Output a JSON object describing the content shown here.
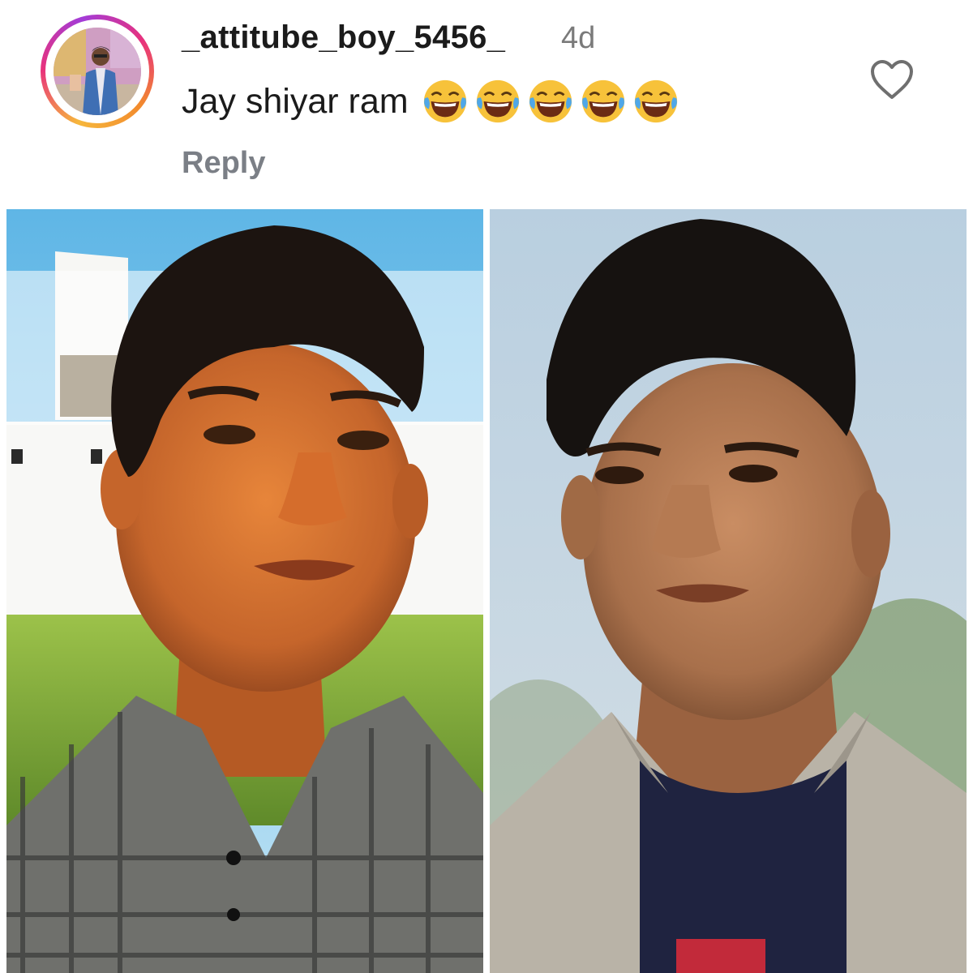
{
  "comment": {
    "username": "_attitube_boy_5456_",
    "timestamp": "4d",
    "text": "Jay shiyar ram",
    "emojis": [
      "😂",
      "😂",
      "😂",
      "😂",
      "😂"
    ],
    "emoji_name": "face-with-tears-of-joy",
    "reply_label": "Reply",
    "like_icon": "heart-outline-icon"
  },
  "photos": [
    {
      "name": "photo-left",
      "description_visible": false
    },
    {
      "name": "photo-right",
      "description_visible": false
    }
  ],
  "colors": {
    "username": "#1b1b1b",
    "timestamp": "#7a7a7a",
    "reply": "#7b7f86",
    "ring_start": "#f6b73c",
    "ring_mid": "#e8327c",
    "ring_end": "#a33cd8"
  }
}
